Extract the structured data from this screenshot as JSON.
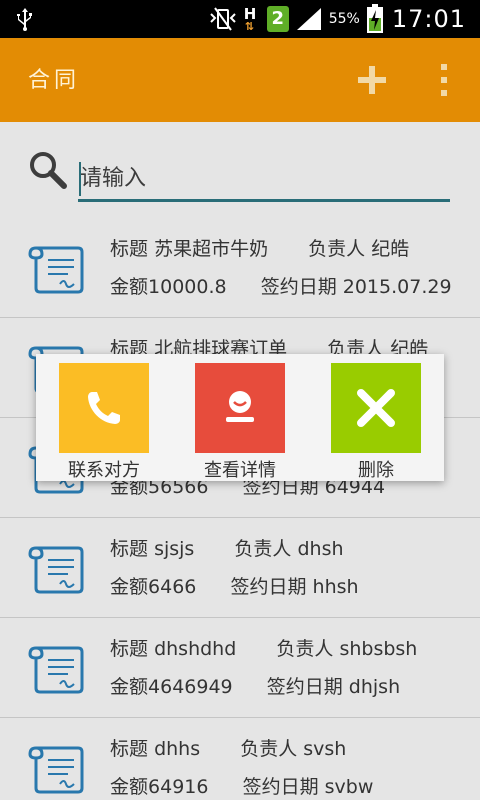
{
  "status_bar": {
    "battery_percent": "55%",
    "time": "17:01",
    "sim": "2",
    "network": "H",
    "icons": [
      "usb-icon",
      "vibrate-icon",
      "network-h-icon",
      "sim-2-icon",
      "signal-icon",
      "battery-charging-icon"
    ]
  },
  "app_bar": {
    "title": "合同",
    "add_icon": "plus-icon",
    "more_icon": "overflow-menu-icon",
    "color": "#e38c04"
  },
  "search": {
    "placeholder": "请输入",
    "value": "",
    "icon": "search-icon",
    "underline_color": "#2e7a86"
  },
  "labels": {
    "title": "标题",
    "owner": "负责人",
    "amount": "金额",
    "date": "签约日期"
  },
  "contracts": [
    {
      "title": "苏果超市牛奶",
      "owner": "纪皓",
      "amount": "10000.8",
      "date": "2015.07.29"
    },
    {
      "title": "北航排球赛订单",
      "owner": "纪皓",
      "amount": "",
      "date": ""
    },
    {
      "title": "",
      "owner": "",
      "amount": "56566",
      "date": "64944"
    },
    {
      "title": "sjsjs",
      "owner": "dhsh",
      "amount": "6466",
      "date": "hhsh"
    },
    {
      "title": "dhshdhd",
      "owner": "shbsbsh",
      "amount": "4646949",
      "date": "dhjsh"
    },
    {
      "title": "dhhs",
      "owner": "svsh",
      "amount": "64916",
      "date": "svbw"
    }
  ],
  "dialog": {
    "actions": [
      {
        "label": "联系对方",
        "icon": "phone-icon",
        "color": "#fbbd25"
      },
      {
        "label": "查看详情",
        "icon": "person-icon",
        "color": "#e74c3c"
      },
      {
        "label": "删除",
        "icon": "close-icon",
        "color": "#99cc00"
      }
    ]
  }
}
